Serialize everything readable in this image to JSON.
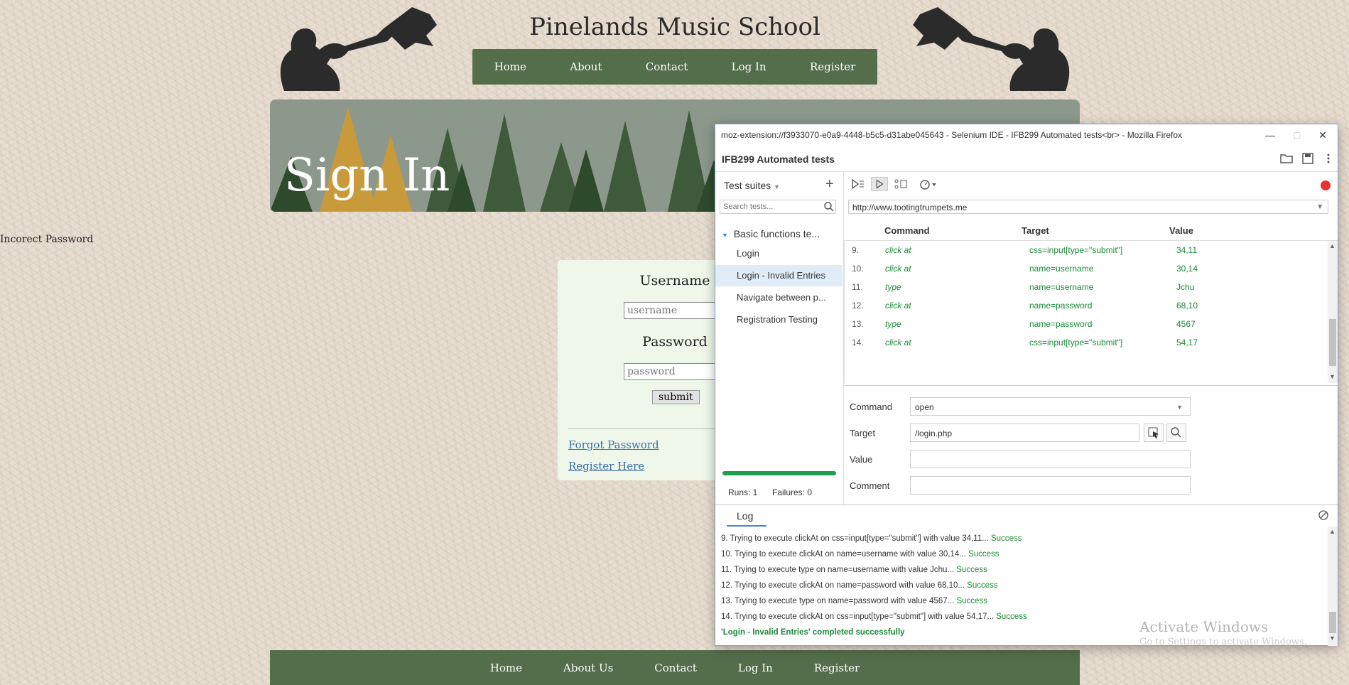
{
  "site": {
    "title": "Pinelands Music School",
    "nav": [
      "Home",
      "About",
      "Contact",
      "Log In",
      "Register"
    ],
    "banner_title": "Sign In",
    "error": "Incorect Password",
    "form": {
      "username_label": "Username",
      "username_placeholder": "username",
      "password_label": "Password",
      "password_placeholder": "password",
      "submit": "submit",
      "forgot": "Forgot Password",
      "register": "Register Here"
    },
    "footer_nav": [
      "Home",
      "About Us",
      "Contact",
      "Log In",
      "Register"
    ],
    "colors": {
      "nav_bg": "#546e4c",
      "card_bg": "#eef7ea"
    }
  },
  "ide": {
    "window_title": "moz-extension://f3933070-e0a9-4448-b5c5-d31abe045643 - Selenium IDE - IFB299 Automated tests<br> - Mozilla Firefox",
    "project": "IFB299 Automated tests",
    "suites_label": "Test suites",
    "search_placeholder": "Search tests...",
    "suite": "Basic functions te...",
    "tests": [
      "Login",
      "Login - Invalid Entries",
      "Navigate between p...",
      "Registration Testing"
    ],
    "active_test": "Login - Invalid Entries",
    "runs": "Runs: 1",
    "failures": "Failures: 0",
    "url": "http://www.tootingtrumpets.me",
    "columns": {
      "command": "Command",
      "target": "Target",
      "value": "Value"
    },
    "rows": [
      {
        "n": "9.",
        "cmd": "click at",
        "target": "css=input[type=\"submit\"]",
        "value": "34,11"
      },
      {
        "n": "10.",
        "cmd": "click at",
        "target": "name=username",
        "value": "30,14"
      },
      {
        "n": "11.",
        "cmd": "type",
        "target": "name=username",
        "value": "Jchu"
      },
      {
        "n": "12.",
        "cmd": "click at",
        "target": "name=password",
        "value": "68,10"
      },
      {
        "n": "13.",
        "cmd": "type",
        "target": "name=password",
        "value": "4567"
      },
      {
        "n": "14.",
        "cmd": "click at",
        "target": "css=input[type=\"submit\"]",
        "value": "54,17"
      }
    ],
    "editor": {
      "command_label": "Command",
      "command_value": "open",
      "target_label": "Target",
      "target_value": "/login.php",
      "value_label": "Value",
      "value_value": "",
      "comment_label": "Comment",
      "comment_value": ""
    },
    "log_tab": "Log",
    "log": [
      {
        "text": "9.  Trying to execute clickAt on css=input[type=\"submit\"] with value 34,11...",
        "status": "Success"
      },
      {
        "text": "10. Trying to execute clickAt on name=username with value 30,14...",
        "status": "Success"
      },
      {
        "text": "11. Trying to execute type on name=username with value Jchu...",
        "status": "Success"
      },
      {
        "text": "12. Trying to execute clickAt on name=password with value 68,10...",
        "status": "Success"
      },
      {
        "text": "13. Trying to execute type on name=password with value 4567...",
        "status": "Success"
      },
      {
        "text": "14. Trying to execute clickAt on css=input[type=\"submit\"] with value 54,17...",
        "status": "Success"
      }
    ],
    "log_done": "'Login - Invalid Entries' completed successfully",
    "colors": {
      "success": "#1a8a37",
      "record": "#e8312f",
      "progress": "#1f9e4f"
    }
  },
  "watermark": {
    "line1": "Activate Windows",
    "line2": "Go to Settings to activate Windows."
  }
}
